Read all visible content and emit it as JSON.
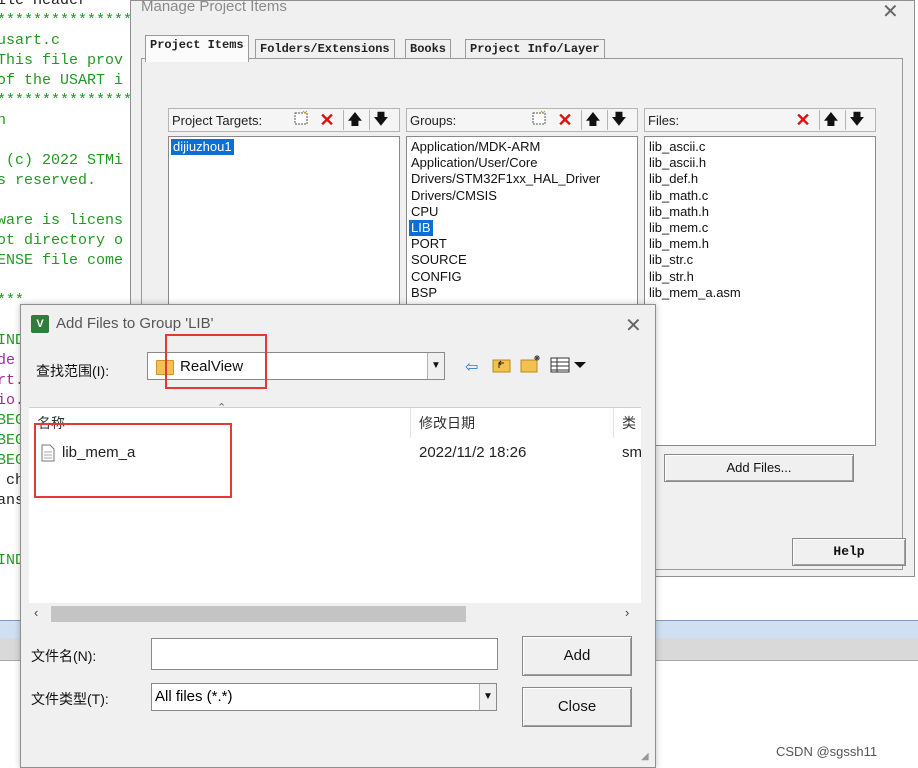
{
  "editor": {
    "lines": [
      {
        "text": "ile Header",
        "color": "c-black"
      },
      {
        "text": "*****************",
        "color": "c-green"
      },
      {
        "text": "usart.c",
        "color": "c-green"
      },
      {
        "text": "This file prov",
        "color": "c-green"
      },
      {
        "text": "of the USART i",
        "color": "c-green"
      },
      {
        "text": "*****************",
        "color": "c-green"
      },
      {
        "text": "n",
        "color": "c-green"
      },
      {
        "text": "",
        "color": "c-green"
      },
      {
        "text": " (c) 2022 STMi",
        "color": "c-green"
      },
      {
        "text": "s reserved.",
        "color": "c-green"
      },
      {
        "text": "",
        "color": "c-green"
      },
      {
        "text": "ware is licens",
        "color": "c-green"
      },
      {
        "text": "ot directory o",
        "color": "c-green"
      },
      {
        "text": "ENSE file come",
        "color": "c-green"
      },
      {
        "text": "",
        "color": "c-green"
      },
      {
        "text": "***",
        "color": "c-green"
      },
      {
        "text": "",
        "color": "c-green"
      },
      {
        "text": "IND",
        "color": "c-green"
      },
      {
        "text": "de",
        "color": "c-purple"
      },
      {
        "text": "rt.",
        "color": "c-purple"
      },
      {
        "text": "io.",
        "color": "c-purple"
      },
      {
        "text": "BEG",
        "color": "c-green"
      },
      {
        "text": "BEG",
        "color": "c-green"
      },
      {
        "text": "BEG",
        "color": "c-green"
      },
      {
        "text": " ch",
        "color": "c-black"
      },
      {
        "text": "ans",
        "color": "c-black"
      },
      {
        "text": "",
        "color": "c-green"
      },
      {
        "text": "",
        "color": "c-green"
      },
      {
        "text": "IND",
        "color": "c-green"
      }
    ]
  },
  "manage_dialog": {
    "title": "Manage Project Items",
    "close_glyph": "✕",
    "tabs": [
      {
        "label": "Project Items",
        "active": true
      },
      {
        "label": "Folders/Extensions",
        "active": false
      },
      {
        "label": "Books",
        "active": false
      },
      {
        "label": "Project Info/Layer",
        "active": false
      }
    ],
    "targets": {
      "header": "Project Targets:",
      "items": [
        "dijiuzhou1"
      ],
      "selected": 0
    },
    "groups": {
      "header": "Groups:",
      "items": [
        "Application/MDK-ARM",
        "Application/User/Core",
        "Drivers/STM32F1xx_HAL_Driver",
        "Drivers/CMSIS",
        "CPU",
        "LIB",
        "PORT",
        "SOURCE",
        "CONFIG",
        "BSP"
      ],
      "selected": 5
    },
    "files": {
      "header": "Files:",
      "items": [
        "lib_ascii.c",
        "lib_ascii.h",
        "lib_def.h",
        "lib_math.c",
        "lib_math.h",
        "lib_mem.c",
        "lib_mem.h",
        "lib_str.c",
        "lib_str.h",
        "lib_mem_a.asm"
      ]
    },
    "add_files_button": "Add Files...",
    "help_button": "Help"
  },
  "add_dialog": {
    "title": "Add Files to Group 'LIB'",
    "app_icon_text": "V",
    "close_glyph": "✕",
    "look_in_label": "查找范围(I):",
    "look_in_value": "RealView",
    "columns": {
      "name": "名称",
      "date": "修改日期",
      "type": "类"
    },
    "files": [
      {
        "name": "lib_mem_a",
        "date": "2022/11/2 18:26",
        "type": "sm"
      }
    ],
    "filename_label": "文件名(N):",
    "filename_value": "",
    "filetype_label": "文件类型(T):",
    "filetype_value": "All files (*.*)",
    "add_button": "Add",
    "close_button": "Close"
  },
  "watermark": "CSDN @sgssh11"
}
